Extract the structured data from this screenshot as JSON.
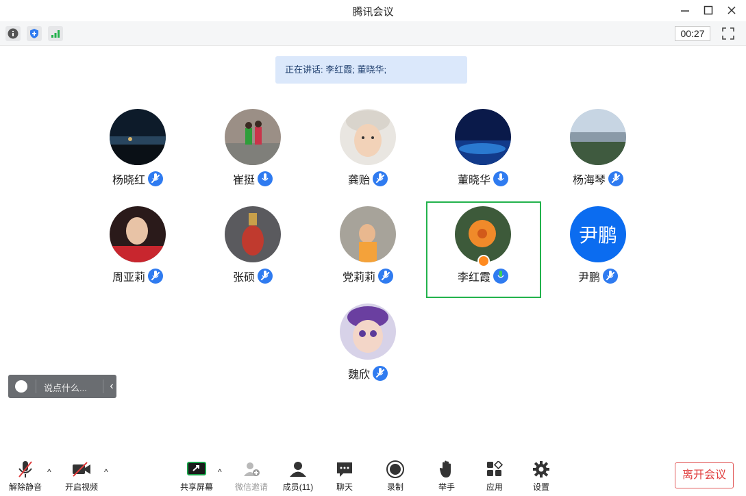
{
  "window": {
    "title": "腾讯会议"
  },
  "infobar": {
    "timer": "00:27"
  },
  "speaking_banner": {
    "text": "正在讲话: 李红霞; 董晓华;"
  },
  "participants": [
    {
      "name": "杨晓红",
      "muted": true
    },
    {
      "name": "崔挺",
      "muted": false
    },
    {
      "name": "龚贻",
      "muted": true
    },
    {
      "name": "董晓华",
      "muted": false
    },
    {
      "name": "杨海琴",
      "muted": true
    },
    {
      "name": "周亚莉",
      "muted": true
    },
    {
      "name": "张硕",
      "muted": true
    },
    {
      "name": "党莉莉",
      "muted": true
    },
    {
      "name": "李红霞",
      "muted": false,
      "speaking": true,
      "host": true
    },
    {
      "name": "尹鹏",
      "muted": true,
      "avatar_text": "尹鹏"
    },
    {
      "name": "魏欣",
      "muted": true
    }
  ],
  "chat": {
    "placeholder": "说点什么..."
  },
  "toolbar": {
    "unmute": "解除静音",
    "start_video": "开启视频",
    "share_screen": "共享屏幕",
    "wechat_invite": "微信邀请",
    "members": "成员(11)",
    "chat": "聊天",
    "record": "录制",
    "raise_hand": "举手",
    "apps": "应用",
    "settings": "设置",
    "leave": "离开会议"
  },
  "colors": {
    "accent": "#0b6cf0",
    "speaking_highlight": "#22b24c",
    "leave": "#e03c3c",
    "banner": "#dbe8fb"
  }
}
